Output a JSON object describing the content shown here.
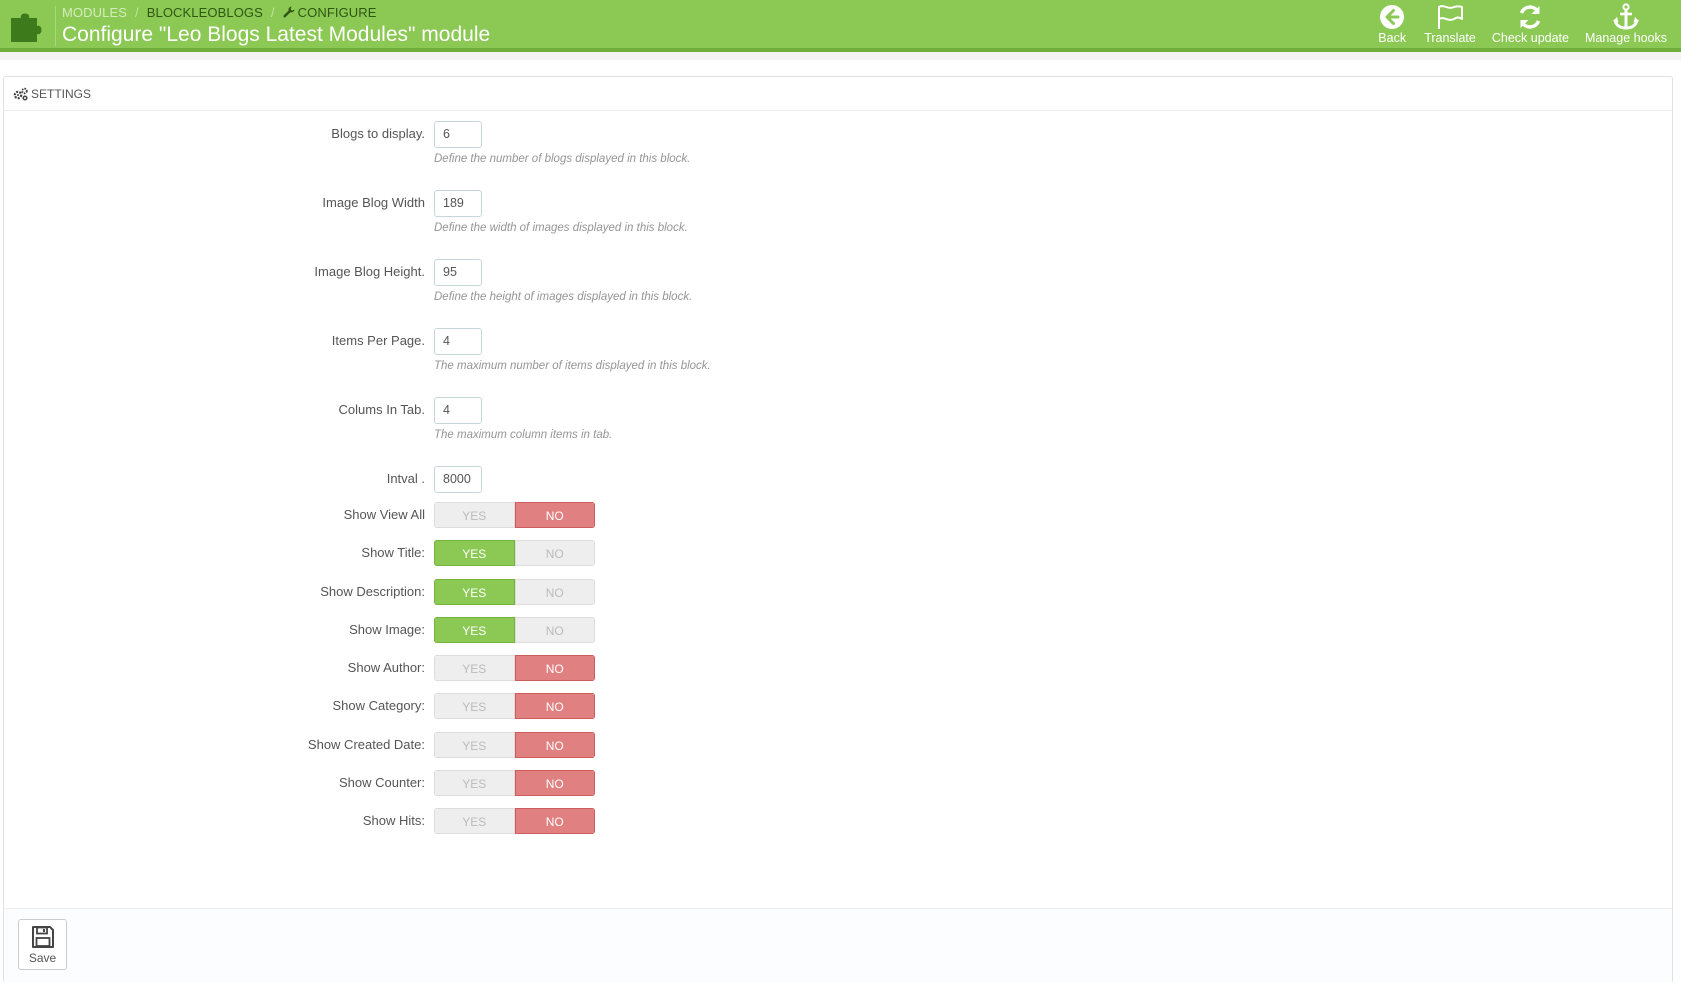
{
  "header": {
    "breadcrumb": [
      "MODULES",
      "BLOCKLEOBLOGS",
      "CONFIGURE"
    ],
    "title": "Configure \"Leo Blogs Latest Modules\" module",
    "toolbar": [
      {
        "label": "Back",
        "icon": "back-circle-arrow-icon"
      },
      {
        "label": "Translate",
        "icon": "flag-icon"
      },
      {
        "label": "Check update",
        "icon": "refresh-icon"
      },
      {
        "label": "Manage hooks",
        "icon": "anchor-icon"
      }
    ],
    "accent_color": "#8bc954"
  },
  "panel": {
    "heading": "SETTINGS",
    "fields": [
      {
        "label": "Blogs to display.",
        "value": "6",
        "help": "Define the number of blogs displayed in this block."
      },
      {
        "label": "Image Blog Width",
        "value": "189",
        "help": "Define the width of images displayed in this block."
      },
      {
        "label": "Image Blog Height.",
        "value": "95",
        "help": "Define the height of images displayed in this block."
      },
      {
        "label": "Items Per Page.",
        "value": "4",
        "help": "The maximum number of items displayed in this block."
      },
      {
        "label": "Colums In Tab.",
        "value": "4",
        "help": "The maximum column items in tab."
      },
      {
        "label": "Intval .",
        "value": "8000",
        "help": ""
      }
    ],
    "switches": [
      {
        "label": "Show View All",
        "value": "NO"
      },
      {
        "label": "Show Title:",
        "value": "YES"
      },
      {
        "label": "Show Description:",
        "value": "YES"
      },
      {
        "label": "Show Image:",
        "value": "YES"
      },
      {
        "label": "Show Author:",
        "value": "NO"
      },
      {
        "label": "Show Category:",
        "value": "NO"
      },
      {
        "label": "Show Created Date:",
        "value": "NO"
      },
      {
        "label": "Show Counter:",
        "value": "NO"
      },
      {
        "label": "Show Hits:",
        "value": "NO"
      }
    ],
    "switch_yes": "YES",
    "switch_no": "NO",
    "save_label": "Save"
  }
}
